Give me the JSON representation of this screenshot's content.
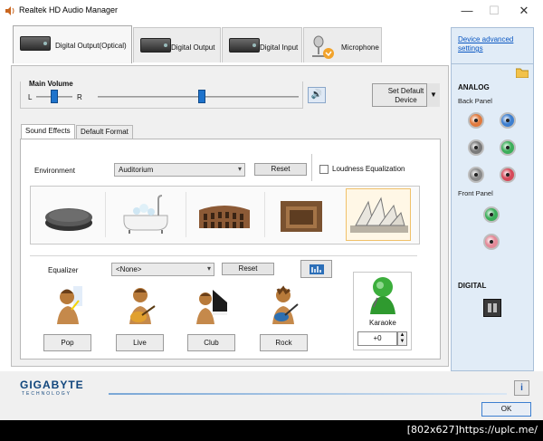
{
  "window": {
    "title": "Realtek HD Audio Manager",
    "controls": {
      "minimize": "—",
      "maximize": "☐",
      "close": "✕"
    }
  },
  "device_tabs": [
    {
      "label": "Digital Output(Optical)",
      "active": true
    },
    {
      "label": "Digital Output",
      "active": false
    },
    {
      "label": "Digital Input",
      "active": false
    },
    {
      "label": "Microphone",
      "active": false
    }
  ],
  "main_volume": {
    "title": "Main Volume",
    "left_label": "L",
    "right_label": "R",
    "balance": 0.5,
    "level": 0.52
  },
  "set_default": {
    "label_line1": "Set Default",
    "label_line2": "Device"
  },
  "sub_tabs": [
    {
      "label": "Sound Effects",
      "active": true
    },
    {
      "label": "Default Format",
      "active": false
    }
  ],
  "environment": {
    "label": "Environment",
    "selected": "Auditorium",
    "reset_label": "Reset",
    "loudness_label": "Loudness Equalization",
    "loudness_checked": false,
    "presets": [
      "stone",
      "bathtub",
      "colosseum",
      "room",
      "auditorium"
    ],
    "selected_index": 4
  },
  "equalizer": {
    "label": "Equalizer",
    "selected": "<None>",
    "reset_label": "Reset",
    "presets": [
      "Pop",
      "Live",
      "Club",
      "Rock"
    ]
  },
  "karaoke": {
    "label": "Karaoke",
    "value": "+0"
  },
  "right_panel": {
    "advanced_link": "Device advanced settings",
    "analog_title": "ANALOG",
    "back_panel_label": "Back Panel",
    "front_panel_label": "Front Panel",
    "digital_title": "DIGITAL",
    "back_jacks": [
      "#e07a3e",
      "#3d7fd0",
      "#7a7a7a",
      "#3cae5a",
      "#8a8a8a",
      "#d64a5a"
    ],
    "front_jacks": [
      "#3cae5a",
      "#e48a98"
    ]
  },
  "footer": {
    "brand": "GIGABYTE",
    "brand_sub": "TECHNOLOGY",
    "info_label": "i",
    "ok_label": "OK"
  },
  "watermark": "[802x627]https://uplc.me/"
}
